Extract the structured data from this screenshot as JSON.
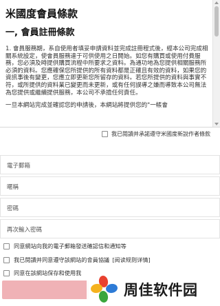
{
  "terms": {
    "title": "米國度會員條款",
    "section_heading": "一, 會員註冊條款",
    "paragraph_1": "1. 會員服務期，系自使用者填妥申請資料並完成註冊程式後，經本公司完成相關系統設定，使會員服務達于可供使用之日開始。如您有購買或使用付費服務，您必須及時提供購買流程中所要求之資料。為通功地為您提供相關服務所必須的資料。您應確保您所提供的所有資料都是正確且有效的資料，如果您的資訊事後有變更，您應立即更新您所留存的資料。若您所提供的資料與事實不符，或所提供的資料業已變更而未更新，或有任何誤導之嫌而導致本公司無法為您提供或繼續提供服務，本公司不承擔任何責任。",
    "paragraph_2_partial": "一旦本網站完成並確認您的申請後，本網站將提供您的\"一帳會"
  },
  "agree_terms_label": "我已閱讀并承諾遵守米國度新說作者條款",
  "form": {
    "email_placeholder": "電子郵箱",
    "nickname_placeholder": "暱稱",
    "password_placeholder": "密碼",
    "password_confirm_placeholder": "再次輸入密碼"
  },
  "options": {
    "email_notify_label": "同意網站向我的電子郵箱發送確認信和通知等",
    "site_agreement_label": "我已閱讀并同意遵守該網站的會員協議",
    "read_rules_link": "[阅读规则详情]",
    "save_use_label": "同意在該網站保存和使用我"
  },
  "watermark": {
    "text": "周佳软件园"
  },
  "colors": {
    "submit_button": "#f0b2b6",
    "border": "#e3e3e3"
  }
}
